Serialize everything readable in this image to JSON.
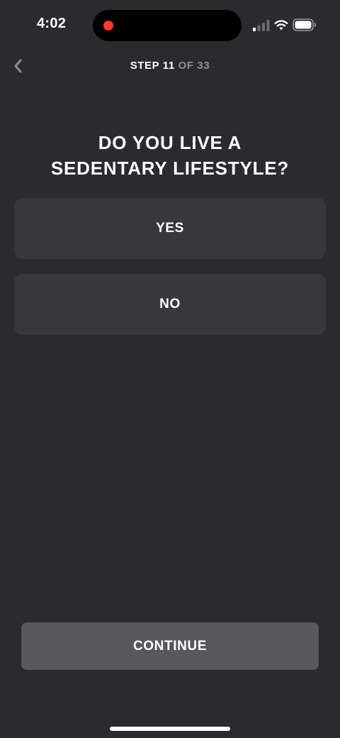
{
  "status_bar": {
    "time": "4:02",
    "icons": [
      "recording-dot-icon",
      "cellular-signal-icon",
      "wifi-icon",
      "battery-icon"
    ]
  },
  "header": {
    "back_icon": "chevron-left-icon",
    "step_label": "STEP 11",
    "step_total": "OF 33"
  },
  "question": {
    "line1": "DO YOU LIVE A",
    "line2": "SEDENTARY LIFESTYLE?"
  },
  "options": [
    {
      "label": "YES"
    },
    {
      "label": "NO"
    }
  ],
  "footer": {
    "continue_label": "CONTINUE"
  },
  "colors": {
    "background": "#2b2a2f",
    "option_bg": "#38373c",
    "continue_bg": "#58575c",
    "muted_text": "#8e8d92",
    "recording": "#ff3b30"
  }
}
